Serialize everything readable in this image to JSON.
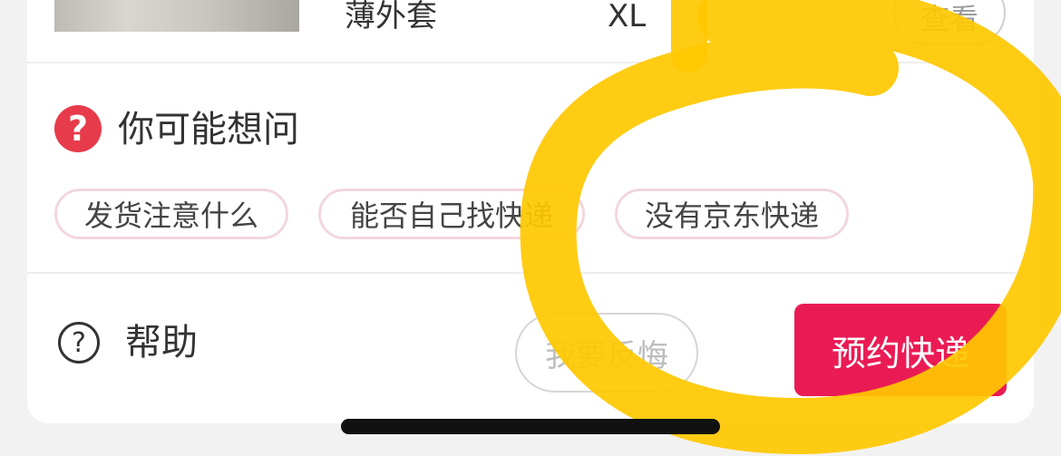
{
  "product": {
    "name": "薄外套",
    "size": "XL",
    "view_label": "查看"
  },
  "faq": {
    "title": "你可能想问",
    "title_icon": "question-mark-icon",
    "chips": [
      "发货注意什么",
      "能否自己找快递",
      "没有京东快递"
    ]
  },
  "footer": {
    "help_label": "帮助",
    "help_icon": "help-circle-icon",
    "regret_label": "我要反悔",
    "book_label": "预约快递"
  },
  "colors": {
    "primary": "#ea1b54",
    "faq_icon": "#e73a4a",
    "chip_border": "#f2d7dc",
    "annotation_highlight": "#ffc800"
  }
}
